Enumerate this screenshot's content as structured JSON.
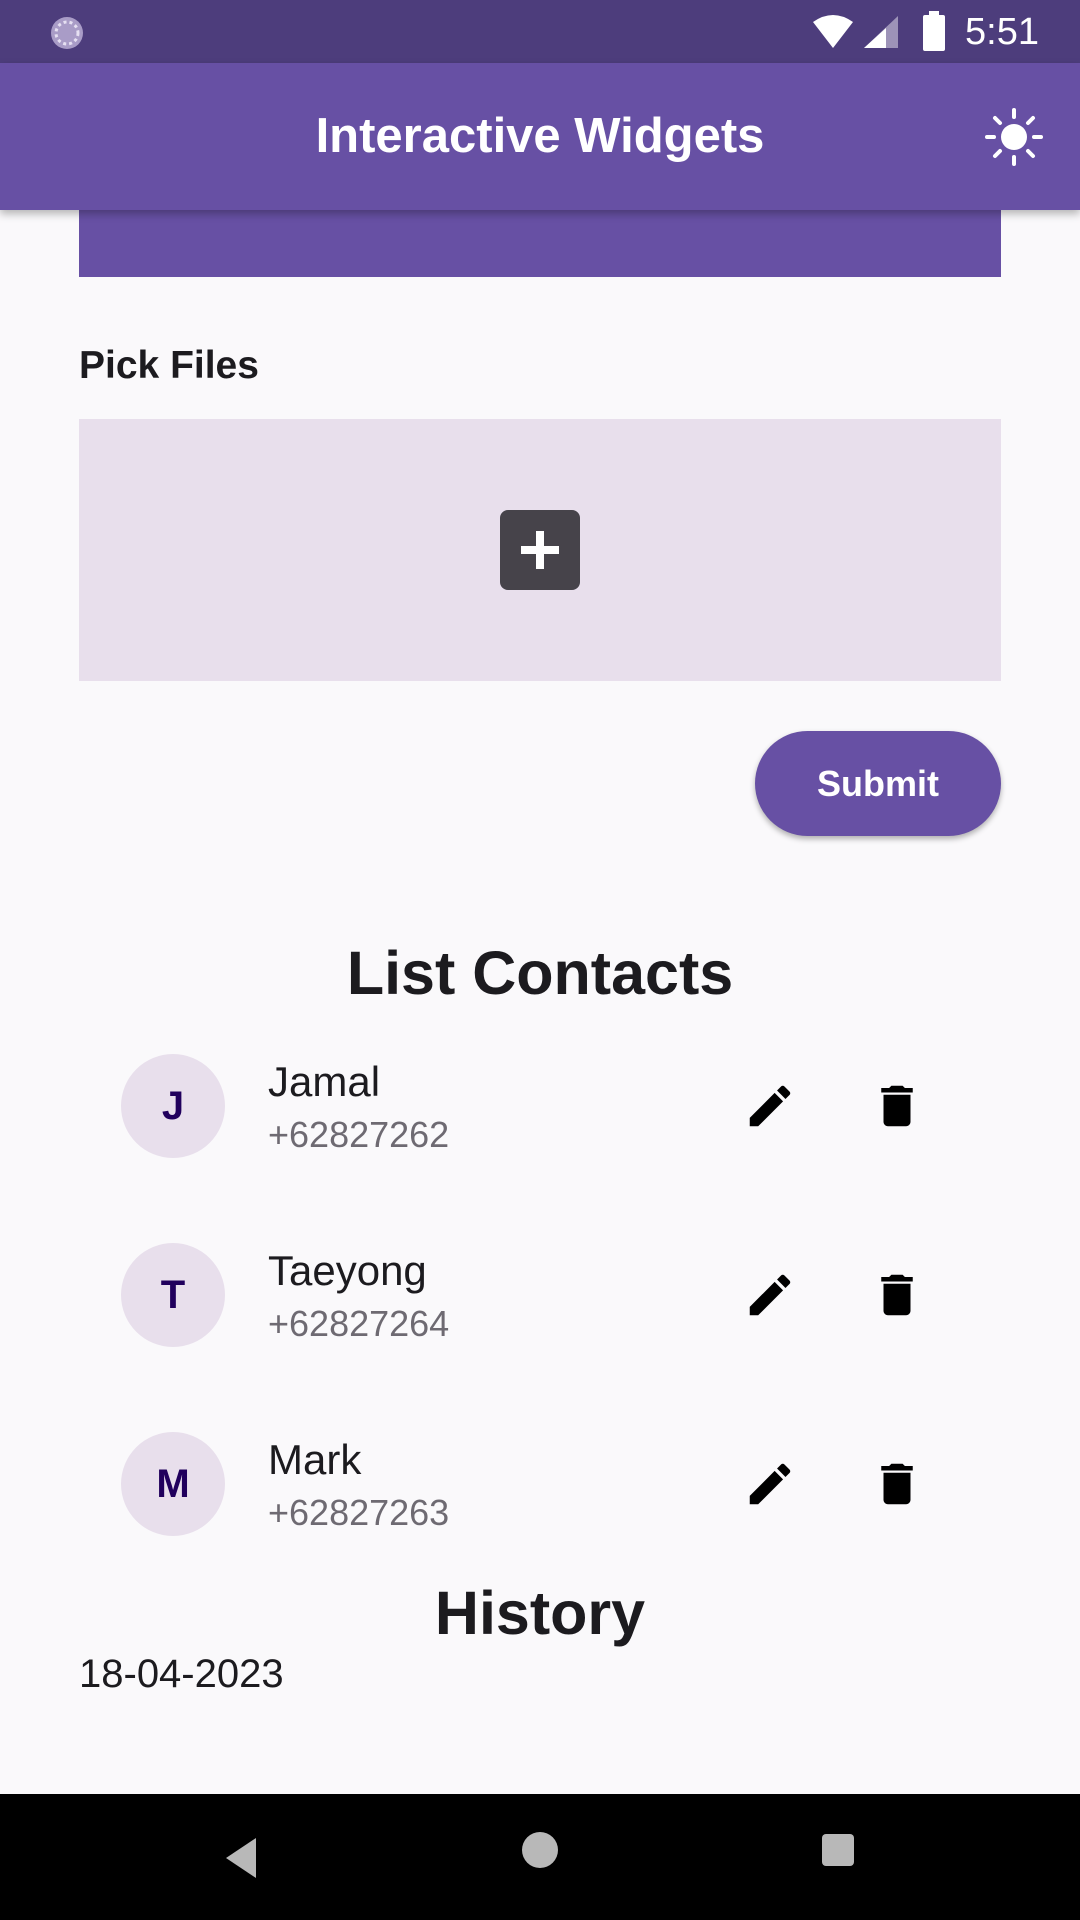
{
  "status_bar": {
    "time": "5:51",
    "icons": [
      "sync-icon",
      "wifi-icon",
      "signal-icon",
      "battery-icon"
    ]
  },
  "app_bar": {
    "title": "Interactive Widgets",
    "action_icon": "sun-icon"
  },
  "file_picker": {
    "label": "Pick Files",
    "icon": "add-box-icon"
  },
  "submit": {
    "label": "Submit"
  },
  "contacts": {
    "title": "List Contacts",
    "items": [
      {
        "initial": "J",
        "name": "Jamal",
        "phone": "+62827262"
      },
      {
        "initial": "T",
        "name": "Taeyong",
        "phone": "+62827264"
      },
      {
        "initial": "M",
        "name": "Mark",
        "phone": "+62827263"
      }
    ]
  },
  "history": {
    "title": "History",
    "date": "18-04-2023"
  },
  "nav_bar": {
    "icons": [
      "back-icon",
      "home-icon",
      "recents-icon"
    ]
  },
  "colors": {
    "primary": "#6750a4",
    "status_bar": "#4d3d7c",
    "surface_variant": "#e8dfec",
    "background": "#faf9fb"
  }
}
